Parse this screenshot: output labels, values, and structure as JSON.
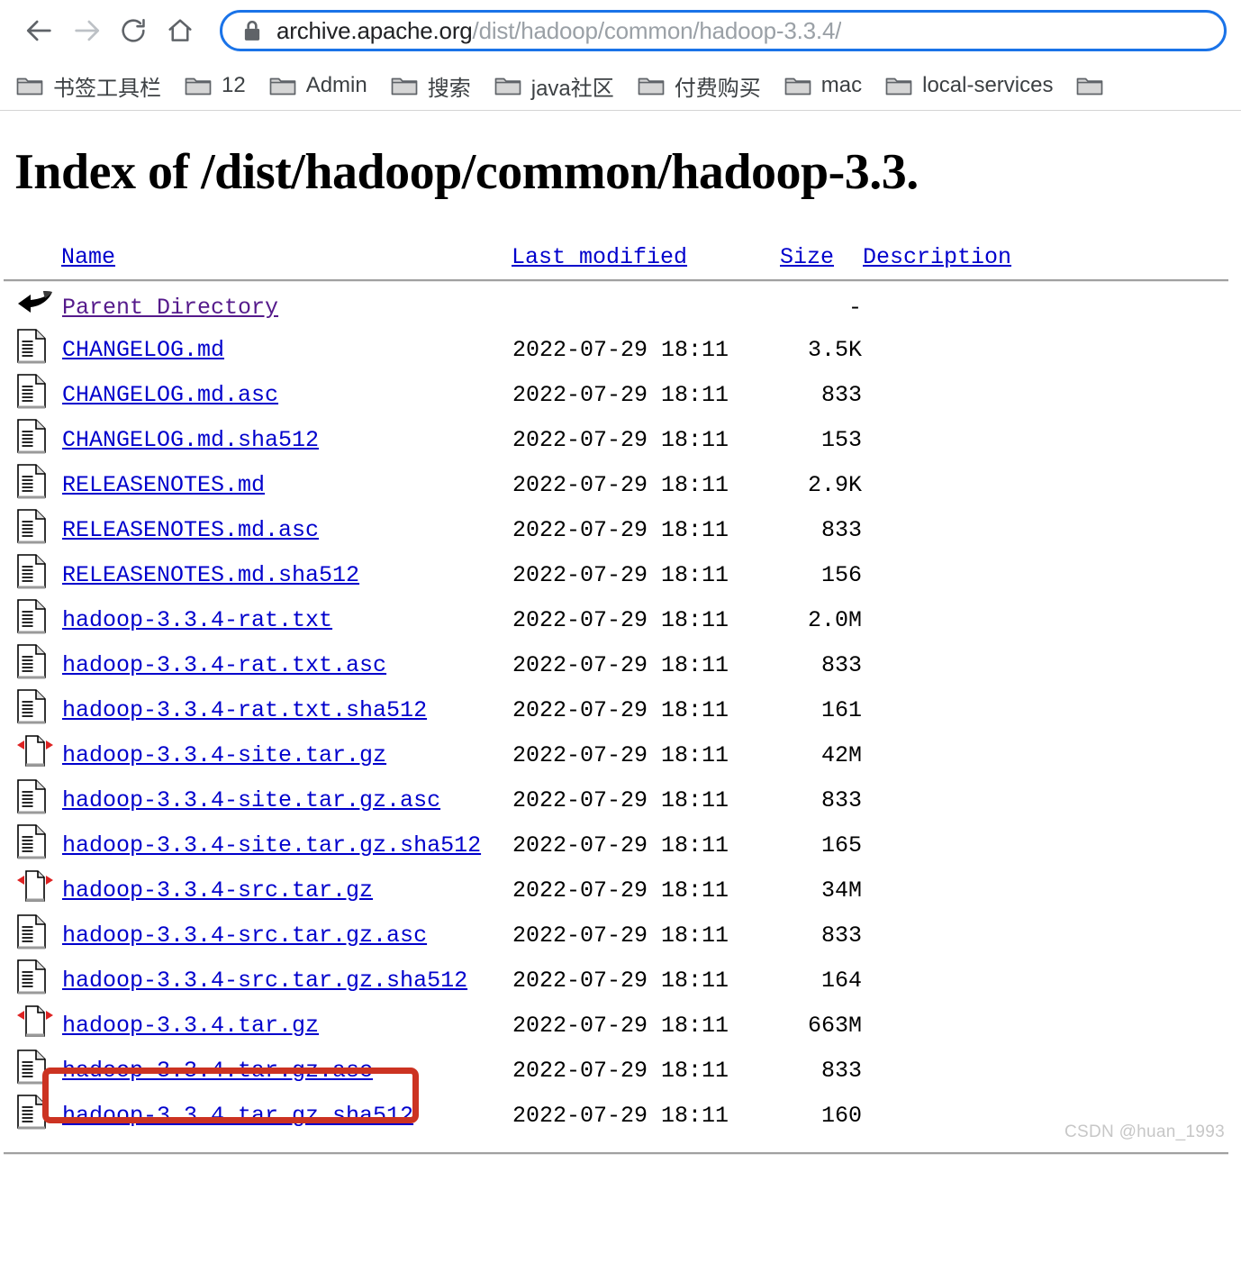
{
  "browser": {
    "nav": {
      "back_icon": "arrow-left-icon",
      "forward_icon": "arrow-right-icon",
      "reload_icon": "reload-icon",
      "home_icon": "home-icon"
    },
    "omnibox": {
      "lock_icon": "lock-icon",
      "domain": "archive.apache.org",
      "path": "/dist/hadoop/common/hadoop-3.3.4/",
      "full_url": "archive.apache.org/dist/hadoop/common/hadoop-3.3.4/"
    },
    "bookmarks": [
      {
        "label": "书签工具栏",
        "icon": "folder-icon"
      },
      {
        "label": "12",
        "icon": "folder-icon"
      },
      {
        "label": "Admin",
        "icon": "folder-icon"
      },
      {
        "label": "搜索",
        "icon": "folder-icon"
      },
      {
        "label": "java社区",
        "icon": "folder-icon"
      },
      {
        "label": "付费购买",
        "icon": "folder-icon"
      },
      {
        "label": "mac",
        "icon": "folder-icon"
      },
      {
        "label": "local-services",
        "icon": "folder-icon"
      },
      {
        "label": "",
        "icon": "folder-icon"
      }
    ]
  },
  "page": {
    "title": "Index of /dist/hadoop/common/hadoop-3.3.",
    "headers": {
      "name": "Name",
      "last_modified": "Last modified",
      "size": "Size",
      "description": "Description"
    },
    "rows": [
      {
        "icon": "back-arrow-icon",
        "name": "Parent Directory",
        "visited": true,
        "date": "",
        "size": "-",
        "desc": ""
      },
      {
        "icon": "text-file-icon",
        "name": "CHANGELOG.md",
        "visited": false,
        "date": "2022-07-29 18:11",
        "size": "3.5K",
        "desc": ""
      },
      {
        "icon": "text-file-icon",
        "name": "CHANGELOG.md.asc",
        "visited": false,
        "date": "2022-07-29 18:11",
        "size": "833",
        "desc": ""
      },
      {
        "icon": "text-file-icon",
        "name": "CHANGELOG.md.sha512",
        "visited": false,
        "date": "2022-07-29 18:11",
        "size": "153",
        "desc": ""
      },
      {
        "icon": "text-file-icon",
        "name": "RELEASENOTES.md",
        "visited": false,
        "date": "2022-07-29 18:11",
        "size": "2.9K",
        "desc": ""
      },
      {
        "icon": "text-file-icon",
        "name": "RELEASENOTES.md.asc",
        "visited": false,
        "date": "2022-07-29 18:11",
        "size": "833",
        "desc": ""
      },
      {
        "icon": "text-file-icon",
        "name": "RELEASENOTES.md.sha512",
        "visited": false,
        "date": "2022-07-29 18:11",
        "size": "156",
        "desc": ""
      },
      {
        "icon": "text-file-icon",
        "name": "hadoop-3.3.4-rat.txt",
        "visited": false,
        "date": "2022-07-29 18:11",
        "size": "2.0M",
        "desc": ""
      },
      {
        "icon": "text-file-icon",
        "name": "hadoop-3.3.4-rat.txt.asc",
        "visited": false,
        "date": "2022-07-29 18:11",
        "size": "833",
        "desc": ""
      },
      {
        "icon": "text-file-icon",
        "name": "hadoop-3.3.4-rat.txt.sha512",
        "visited": false,
        "date": "2022-07-29 18:11",
        "size": "161",
        "desc": ""
      },
      {
        "icon": "compressed-file-icon",
        "name": "hadoop-3.3.4-site.tar.gz",
        "visited": false,
        "date": "2022-07-29 18:11",
        "size": "42M",
        "desc": ""
      },
      {
        "icon": "text-file-icon",
        "name": "hadoop-3.3.4-site.tar.gz.asc",
        "visited": false,
        "date": "2022-07-29 18:11",
        "size": "833",
        "desc": ""
      },
      {
        "icon": "text-file-icon",
        "name": "hadoop-3.3.4-site.tar.gz.sha512",
        "visited": false,
        "date": "2022-07-29 18:11",
        "size": "165",
        "desc": ""
      },
      {
        "icon": "compressed-file-icon",
        "name": "hadoop-3.3.4-src.tar.gz",
        "visited": false,
        "date": "2022-07-29 18:11",
        "size": "34M",
        "desc": ""
      },
      {
        "icon": "text-file-icon",
        "name": "hadoop-3.3.4-src.tar.gz.asc",
        "visited": false,
        "date": "2022-07-29 18:11",
        "size": "833",
        "desc": ""
      },
      {
        "icon": "text-file-icon",
        "name": "hadoop-3.3.4-src.tar.gz.sha512",
        "visited": false,
        "date": "2022-07-29 18:11",
        "size": "164",
        "desc": ""
      },
      {
        "icon": "compressed-file-icon",
        "name": "hadoop-3.3.4.tar.gz",
        "visited": false,
        "date": "2022-07-29 18:11",
        "size": "663M",
        "desc": ""
      },
      {
        "icon": "text-file-icon",
        "name": "hadoop-3.3.4.tar.gz.asc",
        "visited": false,
        "date": "2022-07-29 18:11",
        "size": "833",
        "desc": ""
      },
      {
        "icon": "text-file-icon",
        "name": "hadoop-3.3.4.tar.gz.sha512",
        "visited": false,
        "date": "2022-07-29 18:11",
        "size": "160",
        "desc": ""
      }
    ],
    "annotation": {
      "target_row": "hadoop-3.3.4-src.tar.gz",
      "color": "#cc3322"
    },
    "watermark": "CSDN @huan_1993"
  }
}
